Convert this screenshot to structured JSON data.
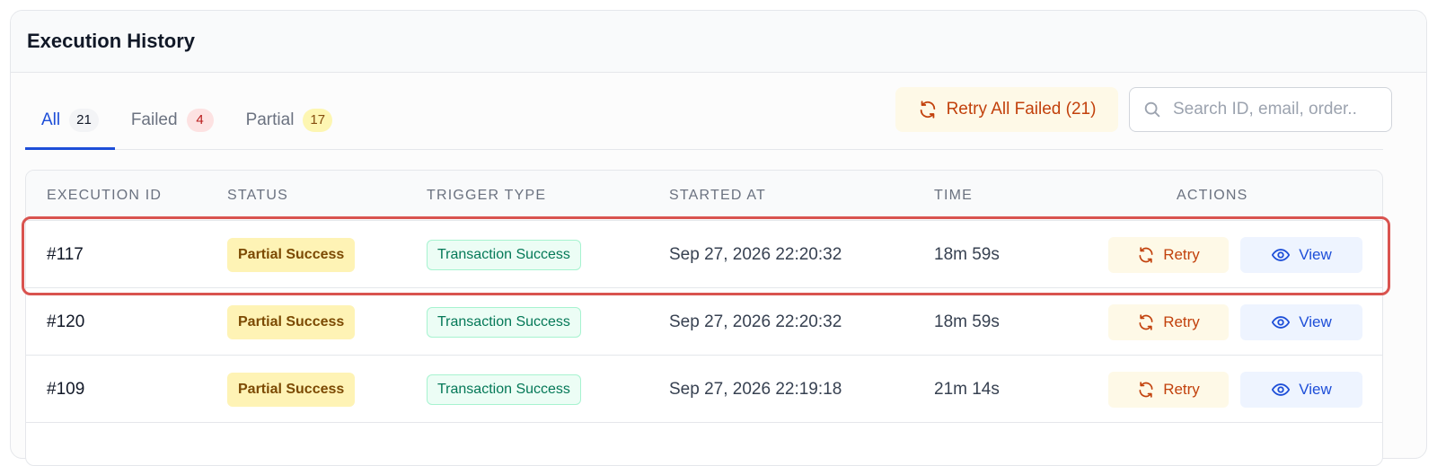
{
  "panel": {
    "title": "Execution History"
  },
  "tabs": [
    {
      "label": "All",
      "count": "21",
      "active": true
    },
    {
      "label": "Failed",
      "count": "4",
      "active": false
    },
    {
      "label": "Partial",
      "count": "17",
      "active": false
    }
  ],
  "toolbar": {
    "retry_all_label": "Retry All Failed (21)",
    "retry_all_icon": "refresh-icon",
    "search_placeholder": "Search ID, email, order..",
    "search_value": "",
    "search_icon": "search-icon"
  },
  "table": {
    "columns": [
      "EXECUTION ID",
      "STATUS",
      "TRIGGER TYPE",
      "STARTED AT",
      "TIME",
      "ACTIONS"
    ],
    "rows": [
      {
        "id": "#117",
        "status": "Partial Success",
        "trigger": "Transaction Success",
        "started_at": "Sep 27, 2026 22:20:32",
        "time": "18m 59s",
        "retry_label": "Retry",
        "view_label": "View",
        "highlighted": true
      },
      {
        "id": "#120",
        "status": "Partial Success",
        "trigger": "Transaction Success",
        "started_at": "Sep 27, 2026 22:20:32",
        "time": "18m 59s",
        "retry_label": "Retry",
        "view_label": "View",
        "highlighted": false
      },
      {
        "id": "#109",
        "status": "Partial Success",
        "trigger": "Transaction Success",
        "started_at": "Sep 27, 2026 22:19:18",
        "time": "21m 14s",
        "retry_label": "Retry",
        "view_label": "View",
        "highlighted": false
      }
    ]
  },
  "colors": {
    "accent": "#1d4ed8",
    "retry": "#c2410c",
    "partial_badge_bg": "#fef3b5",
    "trigger_badge_bg": "#ecfdf5",
    "highlight": "#d9534f"
  }
}
